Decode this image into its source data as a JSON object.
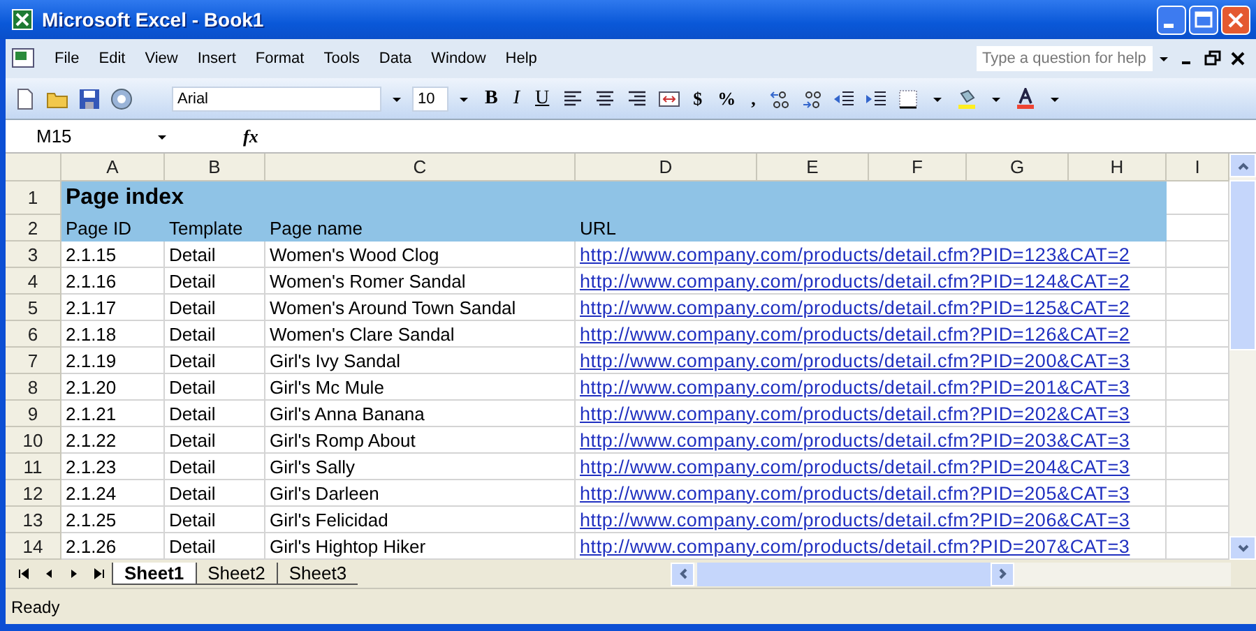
{
  "window": {
    "title": "Microsoft Excel - Book1"
  },
  "menu": [
    "File",
    "Edit",
    "View",
    "Insert",
    "Format",
    "Tools",
    "Data",
    "Window",
    "Help"
  ],
  "help_box": {
    "placeholder": "Type a question for help"
  },
  "toolbar": {
    "font": "Arial",
    "size": "10",
    "style_buttons": [
      "B",
      "I",
      "U"
    ],
    "number_buttons": [
      "$",
      "%",
      ","
    ]
  },
  "formula_bar": {
    "name_box": "M15",
    "fx": "fx"
  },
  "columns": [
    "A",
    "B",
    "C",
    "D",
    "E",
    "F",
    "G",
    "H",
    "I"
  ],
  "rows": [
    {
      "kind": "title",
      "number": "1",
      "text": "Page index"
    },
    {
      "kind": "header",
      "number": "2",
      "cells": [
        "Page ID",
        "Template",
        "Page name",
        "URL"
      ]
    },
    {
      "kind": "data",
      "number": "3",
      "cells": [
        "2.1.15",
        "Detail",
        "Women's Wood Clog",
        "http://www.company.com/products/detail.cfm?PID=123&CAT=2"
      ]
    },
    {
      "kind": "data",
      "number": "4",
      "cells": [
        "2.1.16",
        "Detail",
        "Women's Romer Sandal",
        "http://www.company.com/products/detail.cfm?PID=124&CAT=2"
      ]
    },
    {
      "kind": "data",
      "number": "5",
      "cells": [
        "2.1.17",
        "Detail",
        "Women's Around Town Sandal",
        "http://www.company.com/products/detail.cfm?PID=125&CAT=2"
      ]
    },
    {
      "kind": "data",
      "number": "6",
      "cells": [
        "2.1.18",
        "Detail",
        "Women's Clare Sandal",
        "http://www.company.com/products/detail.cfm?PID=126&CAT=2"
      ]
    },
    {
      "kind": "data",
      "number": "7",
      "cells": [
        "2.1.19",
        "Detail",
        "Girl's Ivy Sandal",
        "http://www.company.com/products/detail.cfm?PID=200&CAT=3"
      ]
    },
    {
      "kind": "data",
      "number": "8",
      "cells": [
        "2.1.20",
        "Detail",
        "Girl's Mc Mule",
        "http://www.company.com/products/detail.cfm?PID=201&CAT=3"
      ]
    },
    {
      "kind": "data",
      "number": "9",
      "cells": [
        "2.1.21",
        "Detail",
        "Girl's Anna Banana",
        "http://www.company.com/products/detail.cfm?PID=202&CAT=3"
      ]
    },
    {
      "kind": "data",
      "number": "10",
      "cells": [
        "2.1.22",
        "Detail",
        "Girl's Romp About",
        "http://www.company.com/products/detail.cfm?PID=203&CAT=3"
      ]
    },
    {
      "kind": "data",
      "number": "11",
      "cells": [
        "2.1.23",
        "Detail",
        "Girl's Sally",
        "http://www.company.com/products/detail.cfm?PID=204&CAT=3"
      ]
    },
    {
      "kind": "data",
      "number": "12",
      "cells": [
        "2.1.24",
        "Detail",
        "Girl's Darleen",
        "http://www.company.com/products/detail.cfm?PID=205&CAT=3"
      ]
    },
    {
      "kind": "data",
      "number": "13",
      "cells": [
        "2.1.25",
        "Detail",
        "Girl's Felicidad",
        "http://www.company.com/products/detail.cfm?PID=206&CAT=3"
      ]
    },
    {
      "kind": "data",
      "number": "14",
      "cells": [
        "2.1.26",
        "Detail",
        "Girl's Hightop Hiker",
        "http://www.company.com/products/detail.cfm?PID=207&CAT=3"
      ]
    }
  ],
  "sheet_tabs": [
    {
      "label": "Sheet1",
      "selected": true
    },
    {
      "label": "Sheet2",
      "selected": false
    },
    {
      "label": "Sheet3",
      "selected": false
    }
  ],
  "status_bar": {
    "text": "Ready"
  }
}
